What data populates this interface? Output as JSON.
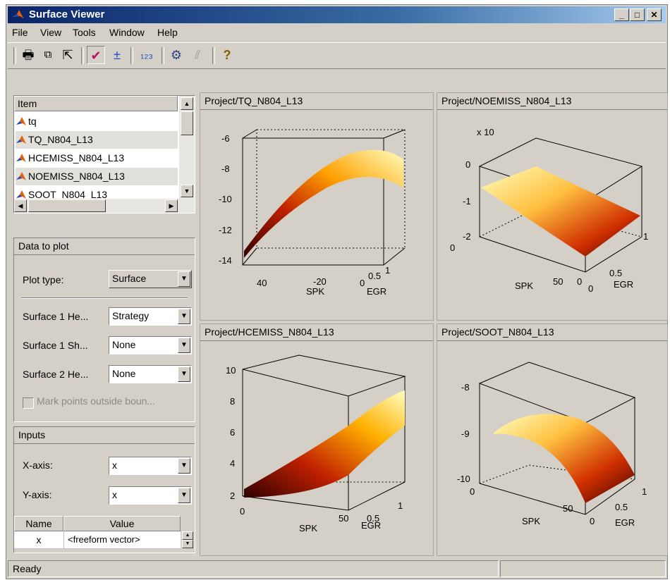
{
  "window": {
    "title": "Surface Viewer"
  },
  "menu": [
    "File",
    "View",
    "Tools",
    "Window",
    "Help"
  ],
  "toolbar": [
    {
      "name": "print-icon",
      "glyph": "🖶"
    },
    {
      "name": "copy-icon",
      "glyph": "⧉"
    },
    {
      "name": "export-icon",
      "glyph": "⇱"
    },
    {
      "name": "check-icon",
      "glyph": "✔"
    },
    {
      "name": "list-compare-icon",
      "glyph": "±"
    },
    {
      "name": "numbers-icon",
      "glyph": "₁₂₃"
    },
    {
      "name": "settings-icon",
      "glyph": "⚙"
    },
    {
      "name": "disabled-tool-icon",
      "glyph": "⫽"
    },
    {
      "name": "help-icon",
      "glyph": "?"
    }
  ],
  "item_list": {
    "header": "Item",
    "items": [
      "tq",
      "TQ_N804_L13",
      "HCEMISS_N804_L13",
      "NOEMISS_N804_L13",
      "SOOT_N804_L13"
    ]
  },
  "data_to_plot": {
    "title": "Data to plot",
    "plot_type_label": "Plot type:",
    "plot_type_value": "Surface",
    "surf1_height_label": "Surface 1 He...",
    "surf1_height_value": "Strategy",
    "surf1_shade_label": "Surface 1 Sh...",
    "surf1_shade_value": "None",
    "surf2_height_label": "Surface 2 He...",
    "surf2_height_value": "None",
    "mark_points_label": "Mark points outside boun..."
  },
  "inputs": {
    "title": "Inputs",
    "xaxis_label": "X-axis:",
    "xaxis_value": "x",
    "yaxis_label": "Y-axis:",
    "yaxis_value": "x",
    "table_headers": [
      "Name",
      "Value"
    ],
    "table_rows": [
      [
        "x",
        "<freeform vector>"
      ]
    ]
  },
  "plots": [
    {
      "title": "Project/TQ_N804_L13",
      "zticks": [
        "-6",
        "-8",
        "-10",
        "-12",
        "-14"
      ],
      "xticks": [
        "40",
        "-20",
        "0"
      ],
      "yticks": [
        "0.5",
        "1"
      ],
      "xlabel": "SPK",
      "ylabel": "EGR",
      "exp": ""
    },
    {
      "title": "Project/NOEMISS_N804_L13",
      "zticks": [
        "0",
        "-1",
        "-2"
      ],
      "xticks": [
        "0",
        "50"
      ],
      "yticks": [
        "0",
        "0.5",
        "1"
      ],
      "xlabel": "SPK",
      "ylabel": "EGR",
      "exp": "x 10"
    },
    {
      "title": "Project/HCEMISS_N804_L13",
      "zticks": [
        "10",
        "8",
        "6",
        "4",
        "2"
      ],
      "xticks": [
        "0",
        "50"
      ],
      "yticks": [
        "0.5",
        "1"
      ],
      "xlabel": "SPK",
      "ylabel": "EGR",
      "exp": ""
    },
    {
      "title": "Project/SOOT_N804_L13",
      "zticks": [
        "-8",
        "-9",
        "-10"
      ],
      "xticks": [
        "0",
        "50"
      ],
      "yticks": [
        "0",
        "0.5",
        "1"
      ],
      "xlabel": "SPK",
      "ylabel": "EGR",
      "exp": ""
    }
  ],
  "status": {
    "text": "Ready"
  }
}
